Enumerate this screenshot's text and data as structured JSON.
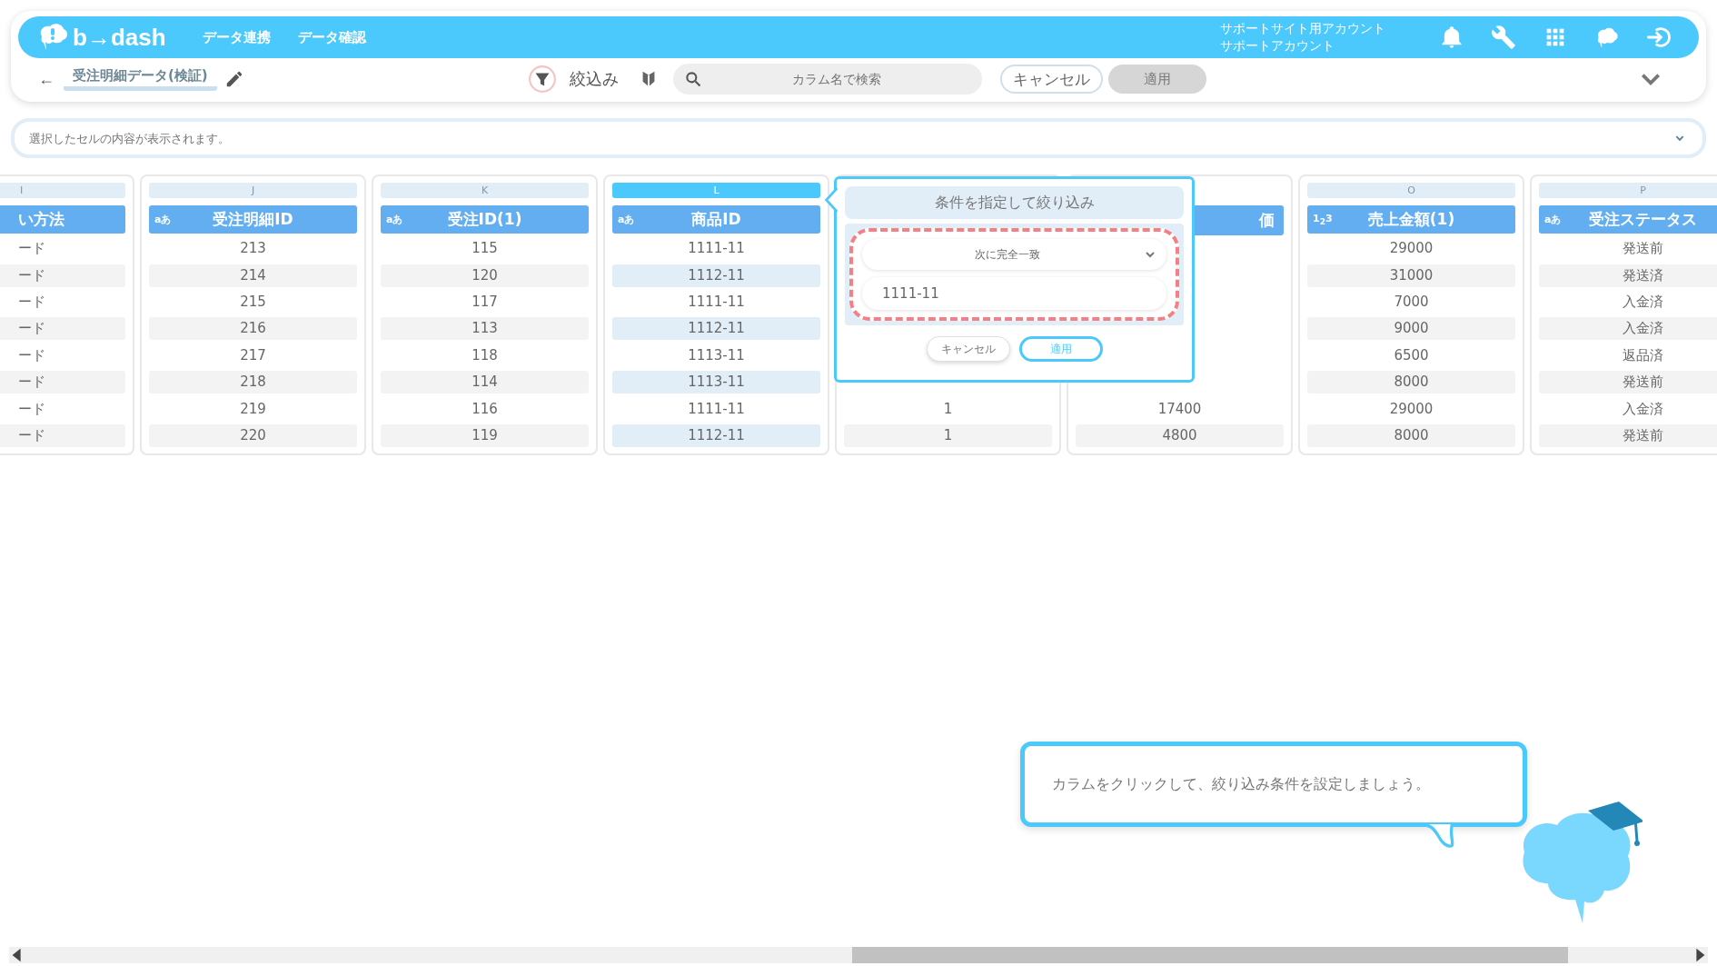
{
  "header": {
    "logo": "b→dash",
    "nav": [
      "データ連携",
      "データ確認"
    ],
    "account": [
      "サポートサイト用アカウント",
      "サポートアカウント"
    ]
  },
  "toolbar": {
    "back": "←",
    "title": "受注明細データ(検証)",
    "filter_label": "絞込み",
    "search": {
      "placeholder": "カラム名で検索"
    },
    "cancel": "キャンセル",
    "apply": {
      "label": "適用",
      "disabled": true
    }
  },
  "cell_preview": {
    "placeholder": "選択したセルの内容が表示されます。"
  },
  "columns": [
    {
      "kind": "full",
      "letter": "I",
      "selected": false,
      "header": "い方法",
      "cells": [
        "ード",
        "ード",
        "ード",
        "ード",
        "ード",
        "ード",
        "ード",
        "ード"
      ]
    },
    {
      "kind": "full",
      "letter": "J",
      "selected": false,
      "type_badge": "aあ",
      "header": "受注明細ID",
      "cells": [
        "213",
        "214",
        "215",
        "216",
        "217",
        "218",
        "219",
        "220"
      ]
    },
    {
      "kind": "full",
      "letter": "K",
      "selected": false,
      "type_badge": "aあ",
      "header": "受注ID(1)",
      "cells": [
        "115",
        "120",
        "117",
        "113",
        "118",
        "114",
        "116",
        "119"
      ]
    },
    {
      "kind": "full",
      "letter": "L",
      "selected": true,
      "type_badge": "aあ",
      "header": "商品ID",
      "cells": [
        "1111-11",
        "1112-11",
        "1111-11",
        "1112-11",
        "1113-11",
        "1113-11",
        "1111-11",
        "1112-11"
      ]
    },
    {
      "kind": "covered",
      "cells": [
        "1",
        "1"
      ]
    },
    {
      "kind": "covered",
      "header": "価",
      "cells": [
        "17400",
        "4800"
      ]
    },
    {
      "kind": "full",
      "letter": "O",
      "selected": false,
      "type_badge": "1$_{2}$3",
      "header": "売上金額(1)",
      "cells": [
        "29000",
        "31000",
        "7000",
        "9000",
        "6500",
        "8000",
        "29000",
        "8000"
      ]
    },
    {
      "kind": "full",
      "letter": "P",
      "selected": false,
      "type_badge": "aあ",
      "header": "受注ステータス",
      "cells": [
        "発送前",
        "発送済",
        "入金済",
        "入金済",
        "返品済",
        "発送前",
        "入金済",
        "発送前"
      ]
    }
  ],
  "filter_popup": {
    "title": "条件を指定して絞り込み",
    "condition": "次に完全一致",
    "value": "1111-11",
    "cancel": "キャンセル",
    "apply": "適用"
  },
  "hint": {
    "text": "カラムをクリックして、絞り込み条件を設定しましょう。"
  }
}
